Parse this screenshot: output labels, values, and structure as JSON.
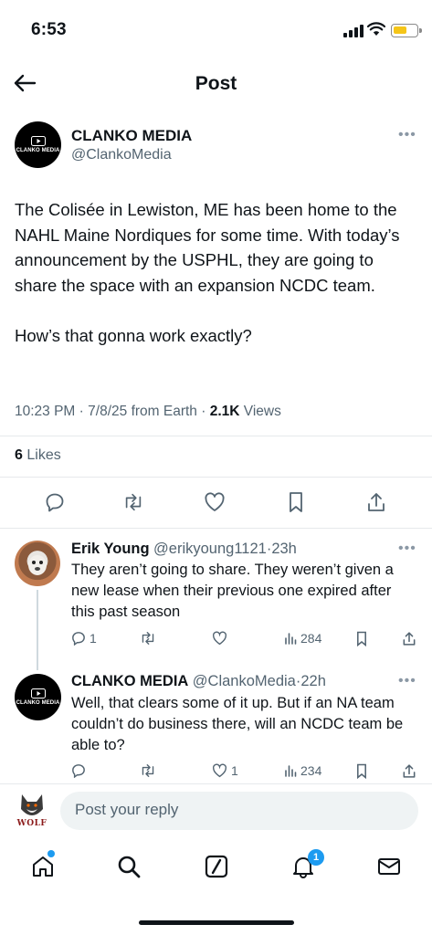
{
  "status_bar": {
    "time": "6:53"
  },
  "header": {
    "title": "Post"
  },
  "post": {
    "author_name": "CLANKO MEDIA",
    "author_handle": "@ClankoMedia",
    "avatar_text": "CLANKO MEDIA",
    "body": "The Colisée in Lewiston, ME has been home to the NAHL Maine Nordiques for some time. With today’s announcement by the USPHL, they are going to share the space with an expansion NCDC team.\n\nHow’s that gonna work exactly?",
    "time": "10:23 PM",
    "date": "7/8/25",
    "source": "from Earth",
    "views_count": "2.1K",
    "views_label": "Views",
    "likes_count": "6",
    "likes_label": "Likes"
  },
  "replies": [
    {
      "name": "Erik Young",
      "handle": "@erikyoung1121",
      "age": "23h",
      "text": "They aren’t going to share. They weren’t given a new lease when their previous one expired after this past season",
      "replies": "1",
      "retweets": "",
      "likes": "",
      "views": "284"
    },
    {
      "name": "CLANKO MEDIA",
      "handle": "@ClankoMedia",
      "age": "22h",
      "avatar_text": "CLANKO MEDIA",
      "text": "Well, that clears some of it up. But if an NA team couldn’t do business there, will an NCDC team be able to?",
      "replies": "",
      "retweets": "",
      "likes": "1",
      "views": "234"
    }
  ],
  "compose": {
    "placeholder": "Post your reply",
    "avatar_text": "WOLF"
  },
  "tabbar": {
    "notifications_badge": "1"
  },
  "colors": {
    "accent": "#1d9bf0",
    "text": "#0f1419",
    "muted": "#536471",
    "battery": "#f5c518"
  }
}
